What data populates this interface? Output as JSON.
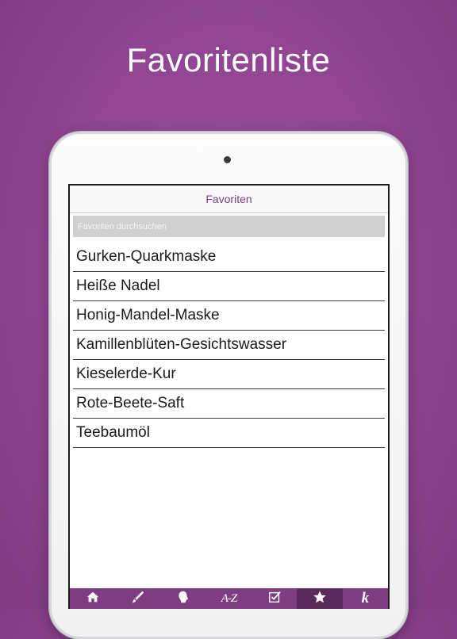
{
  "headline": "Favoritenliste",
  "nav": {
    "title": "Favoriten"
  },
  "search": {
    "placeholder": "Favoriten durchsuchen",
    "value": ""
  },
  "favorites": [
    "Gurken-Quarkmaske",
    "Heiße Nadel",
    "Honig-Mandel-Maske",
    "Kamillenblüten-Gesichtswasser",
    "Kieselerde-Kur",
    "Rote-Beete-Saft",
    "Teebaumöl"
  ],
  "tabbar": {
    "tabs": [
      {
        "icon": "home-icon",
        "label": ""
      },
      {
        "icon": "brush-icon",
        "label": ""
      },
      {
        "icon": "head-icon",
        "label": ""
      },
      {
        "icon": "az-index-icon",
        "label": "A-Z"
      },
      {
        "icon": "checklist-icon",
        "label": ""
      },
      {
        "icon": "star-icon",
        "label": ""
      },
      {
        "icon": "k-logo-icon",
        "label": "k"
      }
    ],
    "active_index": 5
  },
  "colors": {
    "background": "#8f4591",
    "tab_bar": "#7e3d81",
    "tab_active": "#5a2a5c",
    "title_text": "#7d3f80",
    "search_bg": "#d0d0d0"
  }
}
